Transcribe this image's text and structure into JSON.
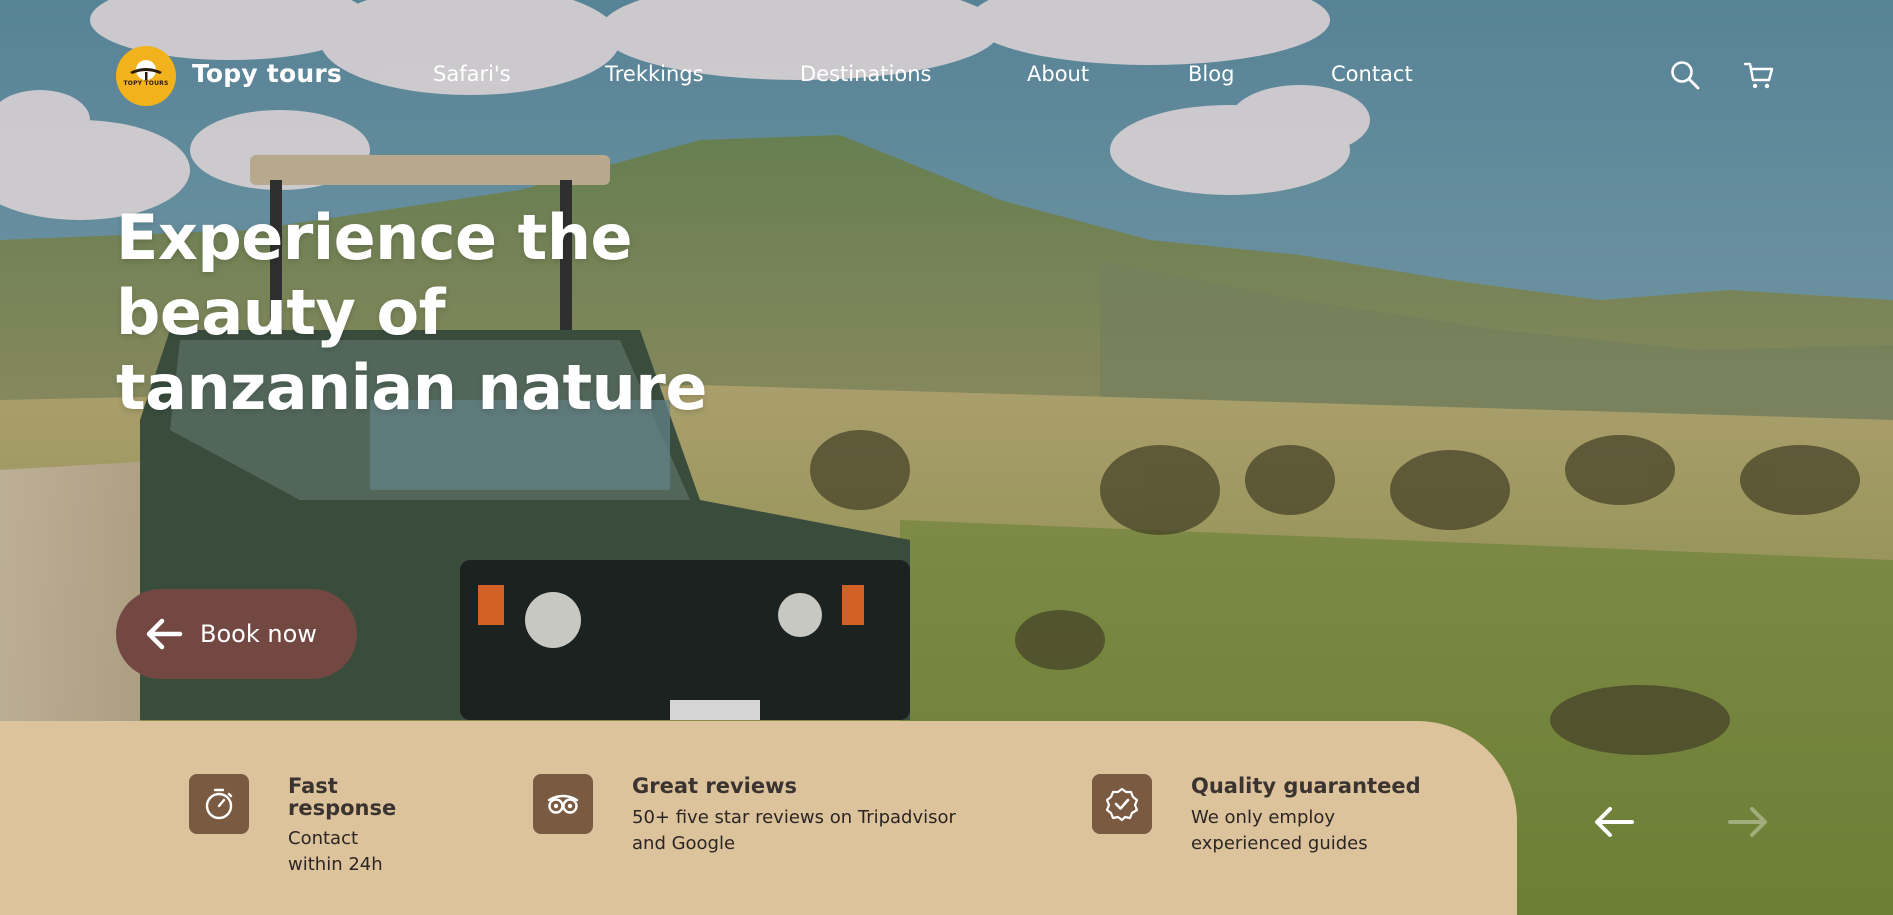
{
  "brand": {
    "logo_text": "TOPY TOURS",
    "name": "Topy tours",
    "logo_color": "#f2b21c"
  },
  "nav": {
    "items": [
      {
        "label": "Safari's"
      },
      {
        "label": "Trekkings"
      },
      {
        "label": "Destinations"
      },
      {
        "label": "About"
      },
      {
        "label": "Blog"
      },
      {
        "label": "Contact"
      }
    ],
    "icons": [
      "search-icon",
      "cart-icon"
    ]
  },
  "hero": {
    "title_lines": [
      "Experience the",
      "beauty of",
      "tanzanian nature"
    ],
    "cta_label": "Book now",
    "cta_color": "#734843"
  },
  "features": {
    "panel_color": "#dcc39c",
    "icon_bg": "#7b5a42",
    "items": [
      {
        "icon": "stopwatch-icon",
        "title_lines": [
          "Fast",
          "response"
        ],
        "text_lines": [
          "Contact",
          "within 24h"
        ]
      },
      {
        "icon": "tripadvisor-icon",
        "title_lines": [
          "Great reviews"
        ],
        "text_lines": [
          "50+ five star reviews on Tripadvisor",
          "and Google"
        ]
      },
      {
        "icon": "verified-badge-icon",
        "title_lines": [
          "Quality guaranteed"
        ],
        "text_lines": [
          "We only employ",
          "experienced guides"
        ]
      }
    ]
  },
  "slider": {
    "icons": [
      "arrow-left-icon",
      "arrow-right-icon"
    ]
  }
}
